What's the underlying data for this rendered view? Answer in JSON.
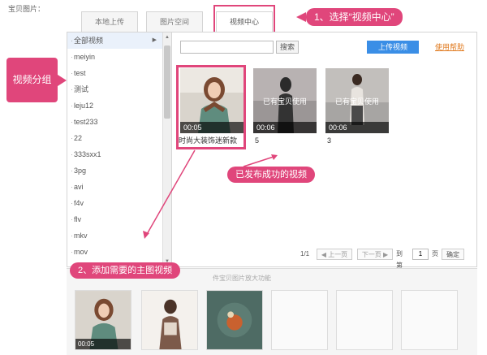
{
  "field_label": "宝贝图片：",
  "tabs": [
    {
      "label": "本地上传"
    },
    {
      "label": "图片空间"
    },
    {
      "label": "视频中心"
    }
  ],
  "annotations": {
    "step1": "1、选择“视频中心”",
    "group_label": "视频分组",
    "published": "已发布成功的视频",
    "step2": "2、添加需要的主图视频"
  },
  "groups": [
    {
      "label": "全部视频"
    },
    {
      "label": "meiyin"
    },
    {
      "label": "test"
    },
    {
      "label": "测试"
    },
    {
      "label": "leju12"
    },
    {
      "label": "test233"
    },
    {
      "label": "22"
    },
    {
      "label": "333sxx1"
    },
    {
      "label": "3pg"
    },
    {
      "label": "avi"
    },
    {
      "label": "f4v"
    },
    {
      "label": "flv"
    },
    {
      "label": "mkv"
    },
    {
      "label": "mov"
    }
  ],
  "toolbar": {
    "search_placeholder": "",
    "search_label": "搜索",
    "upload_label": "上传视频",
    "help_label": "使用帮助"
  },
  "videos": [
    {
      "duration": "00:05",
      "used_text": "",
      "title": "时尚大装饰迷新款"
    },
    {
      "duration": "00:06",
      "used_text": "已有宝贝使用",
      "title": "5"
    },
    {
      "duration": "00:06",
      "used_text": "已有宝贝使用",
      "title": "3"
    }
  ],
  "pager": {
    "page_info": "1/1",
    "prev_label": "◀ 上一页",
    "next_label": "下一页 ▶",
    "goto_prefix": "到第",
    "page_value": "1",
    "goto_suffix": "页",
    "confirm_label": "确定"
  },
  "bottom": {
    "hint": "件宝贝图片放大功能",
    "slots": [
      {
        "duration": "00:05"
      },
      {
        "duration": ""
      },
      {
        "duration": ""
      },
      {
        "duration": ""
      },
      {
        "duration": ""
      },
      {
        "duration": ""
      }
    ]
  },
  "colors": {
    "accent_pink": "#e0467b",
    "upload_blue": "#3a8ee6",
    "help_orange": "#e07a1f"
  }
}
